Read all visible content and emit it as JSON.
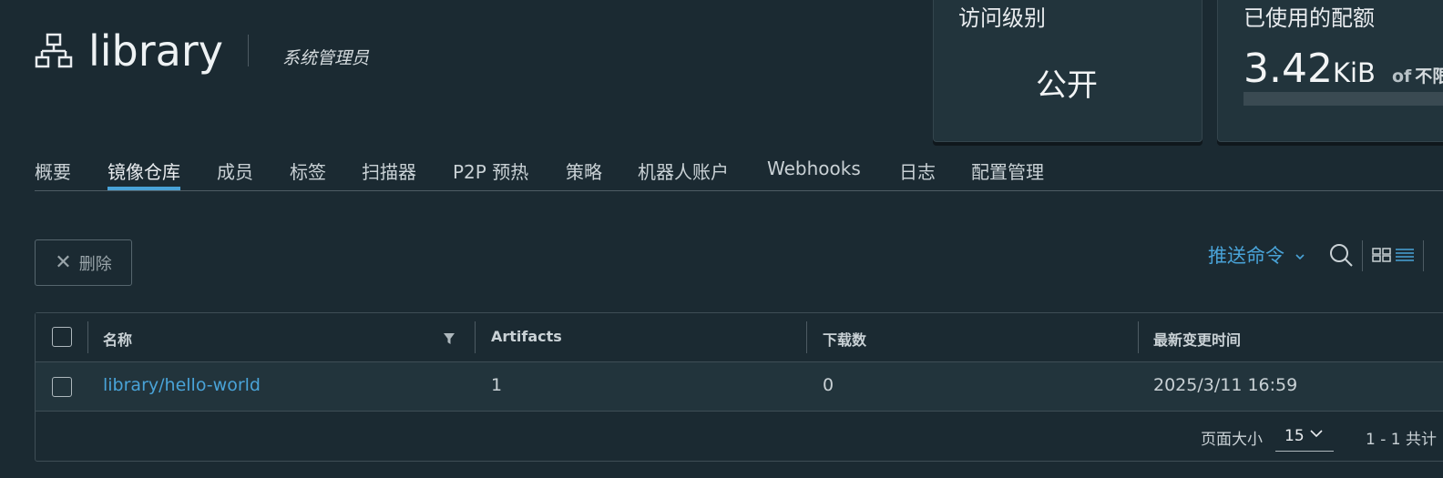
{
  "header": {
    "project_name": "library",
    "role": "系统管理员"
  },
  "cards": {
    "access_level": {
      "title": "访问级别",
      "value": "公开"
    },
    "quota": {
      "title": "已使用的配额",
      "value": "3.42",
      "unit": "KiB",
      "of": "of",
      "limit": "不限",
      "usage_fraction": 0.0
    }
  },
  "tabs": [
    {
      "label": "概要"
    },
    {
      "label": "镜像仓库",
      "active": true
    },
    {
      "label": "成员"
    },
    {
      "label": "标签"
    },
    {
      "label": "扫描器"
    },
    {
      "label": "P2P 预热"
    },
    {
      "label": "策略"
    },
    {
      "label": "机器人账户"
    },
    {
      "label": "Webhooks"
    },
    {
      "label": "日志"
    },
    {
      "label": "配置管理"
    }
  ],
  "toolbar": {
    "delete_label": "删除",
    "push_command_label": "推送命令"
  },
  "table": {
    "columns": [
      "名称",
      "Artifacts",
      "下载数",
      "最新变更时间"
    ],
    "rows": [
      {
        "name": "library/hello-world",
        "artifacts": "1",
        "pulls": "0",
        "updated": "2025/3/11 16:59"
      }
    ],
    "footer": {
      "page_size_label": "页面大小",
      "page_size": "15",
      "range": "1 - 1 共计"
    }
  },
  "colors": {
    "background": "#1b2a32",
    "accent": "#49a3d8",
    "card": "#22343c"
  }
}
